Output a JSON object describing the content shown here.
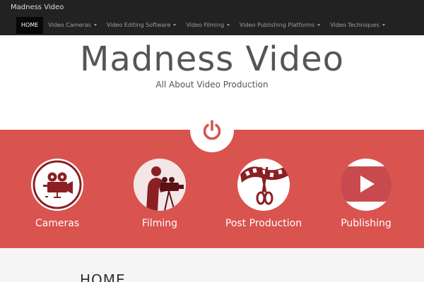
{
  "navbar": {
    "brand": "Madness Video",
    "items": [
      {
        "label": "HOME",
        "active": true,
        "dropdown": false
      },
      {
        "label": "Video Cameras",
        "active": false,
        "dropdown": true
      },
      {
        "label": "Video Editing Software",
        "active": false,
        "dropdown": true
      },
      {
        "label": "Video Filming",
        "active": false,
        "dropdown": true
      },
      {
        "label": "Video Publishing Platforms",
        "active": false,
        "dropdown": true
      },
      {
        "label": "Video Techniques",
        "active": false,
        "dropdown": true
      }
    ]
  },
  "header": {
    "title": "Madness Video",
    "tagline": "All About Video Production"
  },
  "features": {
    "icon": "power-icon",
    "items": [
      {
        "label": "Cameras",
        "icon": "film-camera-icon"
      },
      {
        "label": "Filming",
        "icon": "cameraman-icon"
      },
      {
        "label": "Post Production",
        "icon": "film-strip-scissors-icon"
      },
      {
        "label": "Publishing",
        "icon": "youtube-play-icon"
      }
    ]
  },
  "content": {
    "heading": "HOME"
  },
  "colors": {
    "navbar": "#222222",
    "band": "#d9534f",
    "icon_dark": "#8b1f24"
  }
}
